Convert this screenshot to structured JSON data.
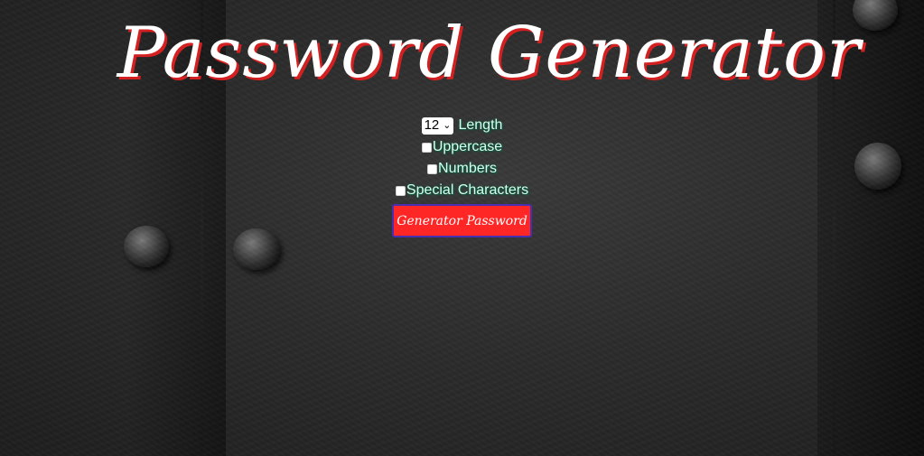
{
  "title": "Password Generator",
  "options": {
    "length_value": "12",
    "length_label": "Length",
    "uppercase_label": "Uppercase",
    "uppercase_checked": false,
    "numbers_label": "Numbers",
    "numbers_checked": false,
    "special_label": "Special Characters",
    "special_checked": false
  },
  "generate_button_label": "Generator Password",
  "colors": {
    "title_text": "#ffffff",
    "title_shadow": "#d42020",
    "label_text": "#d8ffe8",
    "label_glow": "#0b5f4a",
    "button_bg": "#ff2626",
    "button_border": "#4a2fb0"
  },
  "icons": {
    "select_arrow": "chevron-down-icon"
  }
}
